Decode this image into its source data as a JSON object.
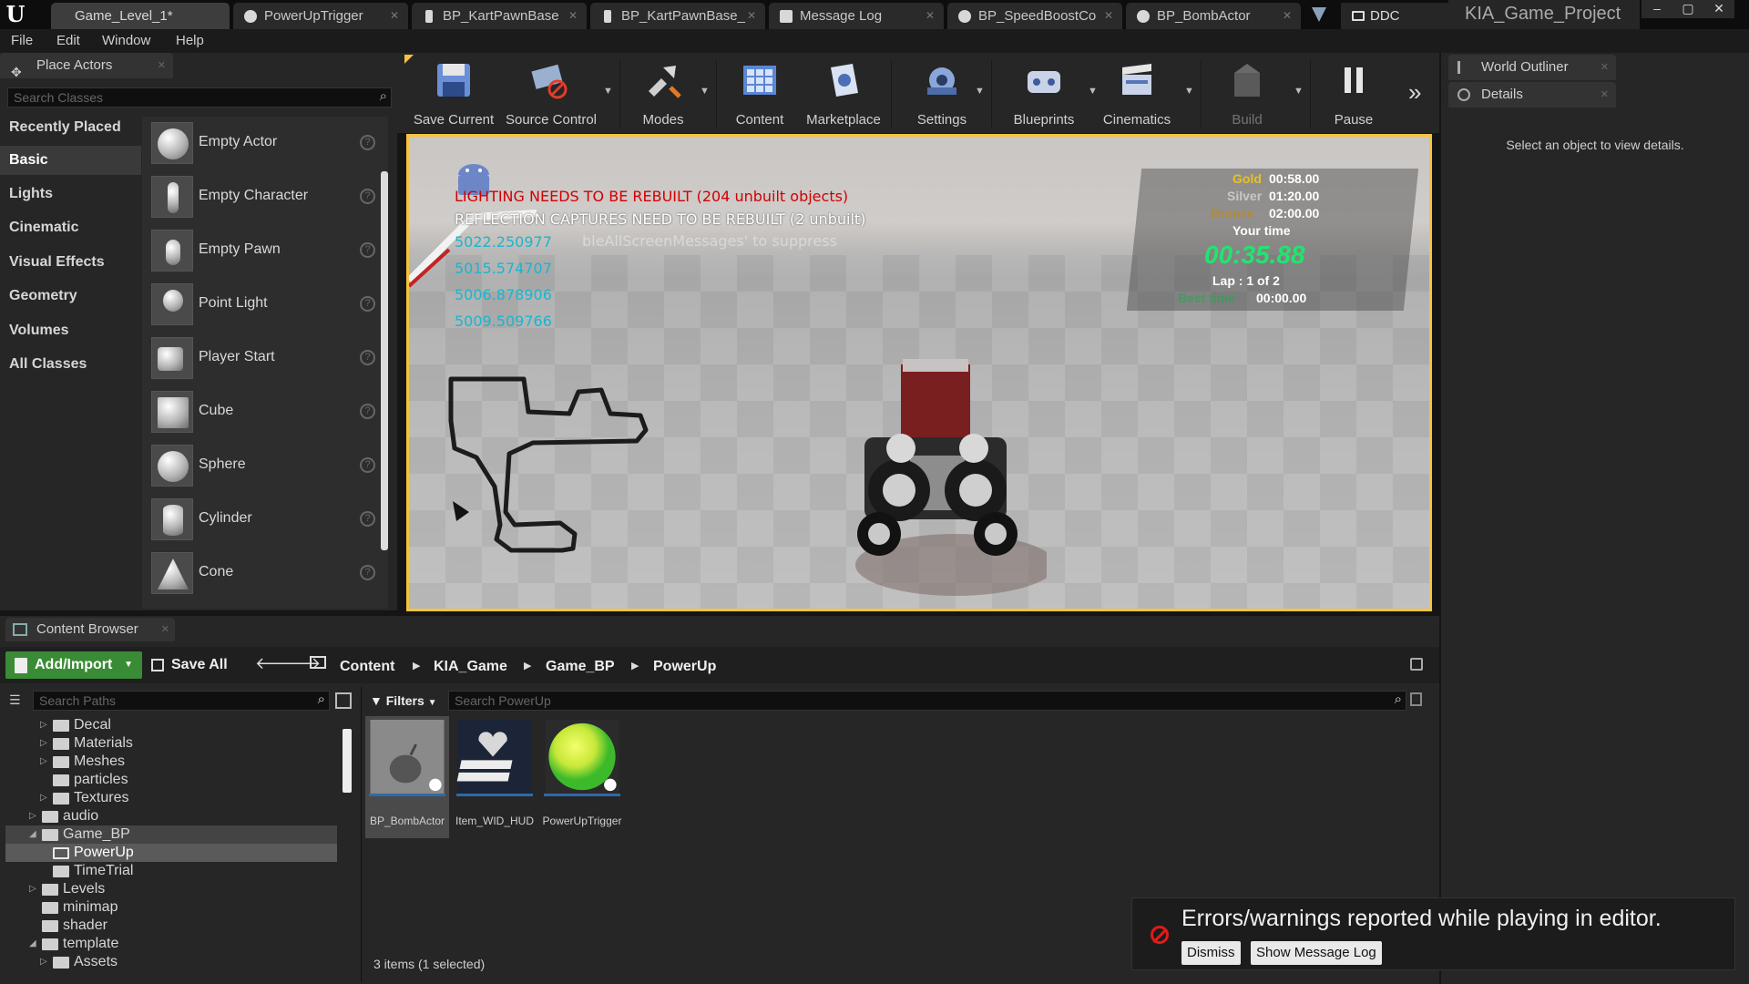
{
  "titlebar": {
    "tabs": [
      {
        "label": "Game_Level_1*"
      },
      {
        "label": "PowerUpTrigger"
      },
      {
        "label": "BP_KartPawnBase"
      },
      {
        "label": "BP_KartPawnBase_"
      },
      {
        "label": "Message Log"
      },
      {
        "label": "BP_SpeedBoostCo"
      },
      {
        "label": "BP_BombActor"
      }
    ],
    "ddc": "DDC",
    "project": "KIA_Game_Project",
    "logo": "U"
  },
  "menu": [
    "File",
    "Edit",
    "Window",
    "Help"
  ],
  "place_actors": {
    "title": "Place Actors",
    "search_placeholder": "Search Classes",
    "categories": [
      "Recently Placed",
      "Basic",
      "Lights",
      "Cinematic",
      "Visual Effects",
      "Geometry",
      "Volumes",
      "All Classes"
    ],
    "selected_category": "Basic",
    "items": [
      {
        "label": "Empty Actor",
        "icon": "sphere-icon"
      },
      {
        "label": "Empty Character",
        "icon": "character-icon"
      },
      {
        "label": "Empty Pawn",
        "icon": "pawn-icon"
      },
      {
        "label": "Point Light",
        "icon": "light-bulb-icon"
      },
      {
        "label": "Player Start",
        "icon": "player-start-icon"
      },
      {
        "label": "Cube",
        "icon": "cube-icon"
      },
      {
        "label": "Sphere",
        "icon": "sphere-icon"
      },
      {
        "label": "Cylinder",
        "icon": "cylinder-icon"
      },
      {
        "label": "Cone",
        "icon": "cone-icon"
      }
    ]
  },
  "toolbar": {
    "buttons": [
      {
        "label": "Save Current",
        "icon": "save-icon"
      },
      {
        "label": "Source Control",
        "icon": "source-control-icon"
      },
      {
        "label": "Modes",
        "icon": "modes-icon"
      },
      {
        "label": "Content",
        "icon": "content-icon"
      },
      {
        "label": "Marketplace",
        "icon": "marketplace-icon"
      },
      {
        "label": "Settings",
        "icon": "settings-icon"
      },
      {
        "label": "Blueprints",
        "icon": "blueprints-icon"
      },
      {
        "label": "Cinematics",
        "icon": "cinematics-icon"
      },
      {
        "label": "Build",
        "icon": "build-icon"
      },
      {
        "label": "Pause",
        "icon": "pause-icon"
      }
    ]
  },
  "viewport": {
    "messages": {
      "lighting": "LIGHTING NEEDS TO BE REBUILT (204 unbuilt objects)",
      "reflection": "REFLECTION CAPTURES NEED TO BE REBUILT (2 unbuilt)",
      "hint": "bleAllScreenMessages' to suppress"
    },
    "numbers": [
      "5022.250977",
      "5015.574707",
      "5006.878906",
      "5009.509766"
    ],
    "hud": {
      "gold_label": "Gold",
      "gold_time": "00:58.00",
      "silver_label": "Silver",
      "silver_time": "01:20.00",
      "bronze_label": "Bronze",
      "bronze_time": "02:00.00",
      "your_time_label": "Your time",
      "current_time": "00:35.88",
      "lap": "Lap  :  1 of 2",
      "best_label": "Best time",
      "best_time": "00:00.00",
      "colors": {
        "gold": "#e8c21a",
        "silver": "#c8c8c8",
        "bronze": "#b08a3a",
        "time": "#22e46e"
      }
    }
  },
  "right_panel": {
    "world_outliner": "World Outliner",
    "details": "Details",
    "details_hint": "Select an object to view details."
  },
  "content_browser": {
    "title": "Content Browser",
    "add_import": "Add/Import",
    "save_all": "Save All",
    "breadcrumb": [
      "Content",
      "KIA_Game",
      "Game_BP",
      "PowerUp"
    ],
    "search_paths_placeholder": "Search Paths",
    "filters": "Filters",
    "search_placeholder": "Search PowerUp",
    "tree": [
      {
        "label": "Decal",
        "arrow": "▷",
        "depth": 1
      },
      {
        "label": "Materials",
        "arrow": "▷",
        "depth": 1
      },
      {
        "label": "Meshes",
        "arrow": "▷",
        "depth": 1
      },
      {
        "label": "particles",
        "arrow": "",
        "depth": 1
      },
      {
        "label": "Textures",
        "arrow": "▷",
        "depth": 1
      },
      {
        "label": "audio",
        "arrow": "▷",
        "depth": 0
      },
      {
        "label": "Game_BP",
        "arrow": "◢",
        "depth": 0
      },
      {
        "label": "PowerUp",
        "arrow": "",
        "depth": 1
      },
      {
        "label": "TimeTrial",
        "arrow": "",
        "depth": 1
      },
      {
        "label": "Levels",
        "arrow": "▷",
        "depth": 0
      },
      {
        "label": "minimap",
        "arrow": "",
        "depth": 0
      },
      {
        "label": "shader",
        "arrow": "",
        "depth": 0
      },
      {
        "label": "template",
        "arrow": "◢",
        "depth": 0
      },
      {
        "label": "Assets",
        "arrow": "▷",
        "depth": 1
      }
    ],
    "assets": [
      {
        "label": "BP_BombActor",
        "selected": true
      },
      {
        "label": "Item_WID_HUD",
        "selected": false
      },
      {
        "label": "PowerUpTrigger",
        "selected": false
      }
    ],
    "item_count": "3 items (1 selected)"
  },
  "toast": {
    "message": "Errors/warnings reported while playing in editor.",
    "dismiss": "Dismiss",
    "show_log": "Show Message Log"
  }
}
